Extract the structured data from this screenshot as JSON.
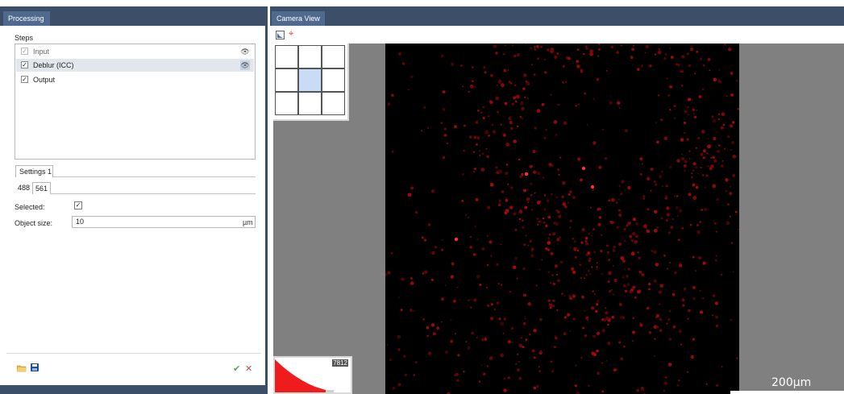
{
  "left_panel": {
    "tab_title": "Processing",
    "steps_label": "Steps",
    "steps": [
      {
        "label": "Input",
        "checked": true,
        "enabled": false,
        "selected": false
      },
      {
        "label": "Deblur (ICC)",
        "checked": true,
        "enabled": true,
        "selected": true
      },
      {
        "label": "Output",
        "checked": true,
        "enabled": true,
        "selected": false
      }
    ],
    "settings_tab": "Settings 1",
    "channel_tabs": [
      "488",
      "561"
    ],
    "active_channel": "561",
    "fields": {
      "selected_label": "Selected:",
      "selected_checked": true,
      "object_size_label": "Object size:",
      "object_size_value": "10",
      "object_size_unit": "µm"
    }
  },
  "right_panel": {
    "tab_title": "Camera View",
    "histogram_max": "7812",
    "scale_bar": "200µm"
  },
  "colors": {
    "tab_bar": "#3c4f68",
    "tab_active": "#4e6a8e",
    "viewport_bg": "#808080",
    "image_bg": "#000000",
    "signal": "#c01818",
    "grid_active": "#c9dcf5",
    "accept": "#5aa05a",
    "cancel": "#c0504d"
  }
}
